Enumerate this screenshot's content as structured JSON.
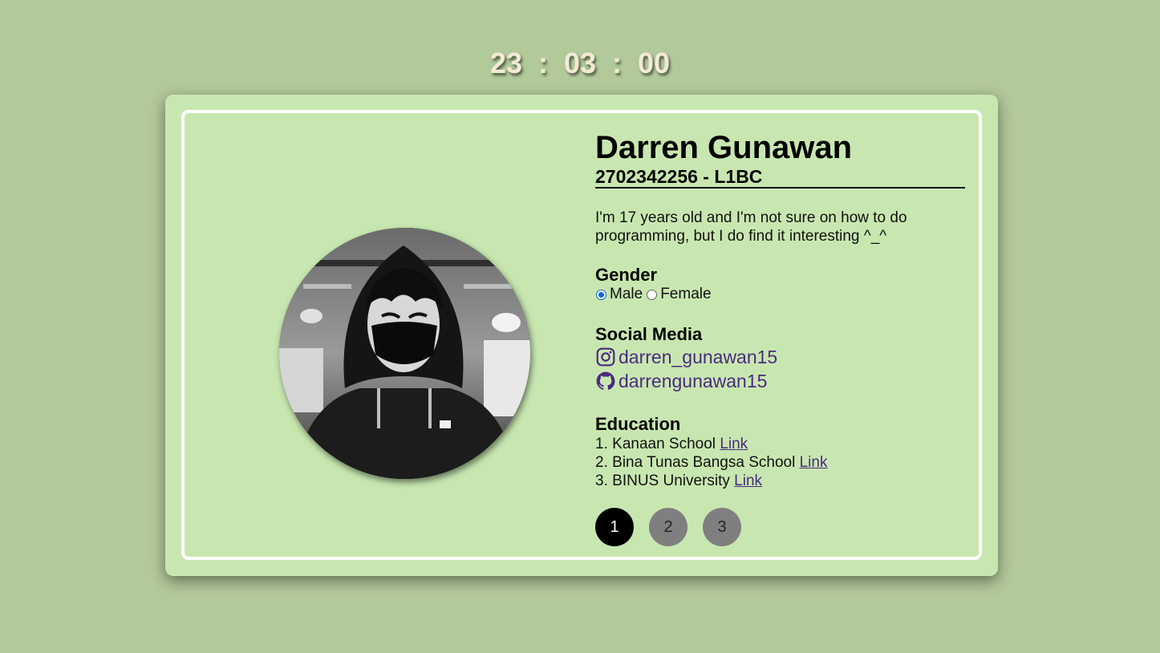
{
  "clock": {
    "hours": "23",
    "minutes": "03",
    "seconds": "00",
    "separator": ":"
  },
  "profile": {
    "name": "Darren Gunawan",
    "student_id": "2702342256 - L1BC",
    "bio": "I'm 17 years old and I'm not sure on how to do programming, but I do find it interesting ^_^"
  },
  "gender": {
    "title": "Gender",
    "options": [
      {
        "label": "Male",
        "checked": true
      },
      {
        "label": "Female",
        "checked": false
      }
    ]
  },
  "social": {
    "title": "Social Media",
    "items": [
      {
        "icon": "instagram-icon",
        "handle": "darren_gunawan15"
      },
      {
        "icon": "github-icon",
        "handle": "darrengunawan15"
      }
    ]
  },
  "education": {
    "title": "Education",
    "items": [
      {
        "number": "1.",
        "school": "Kanaan School",
        "link": "Link"
      },
      {
        "number": "2.",
        "school": "Bina Tunas Bangsa School",
        "link": "Link"
      },
      {
        "number": "3.",
        "school": "BINUS University",
        "link": "Link"
      }
    ]
  },
  "pagination": {
    "pages": [
      "1",
      "2",
      "3"
    ],
    "active": "1"
  },
  "colors": {
    "background": "#b2c99a",
    "card": "#c8e7b0",
    "clock_text": "#f3ead4",
    "link": "#4b2a7f",
    "radio_accent": "#0a66d8"
  }
}
